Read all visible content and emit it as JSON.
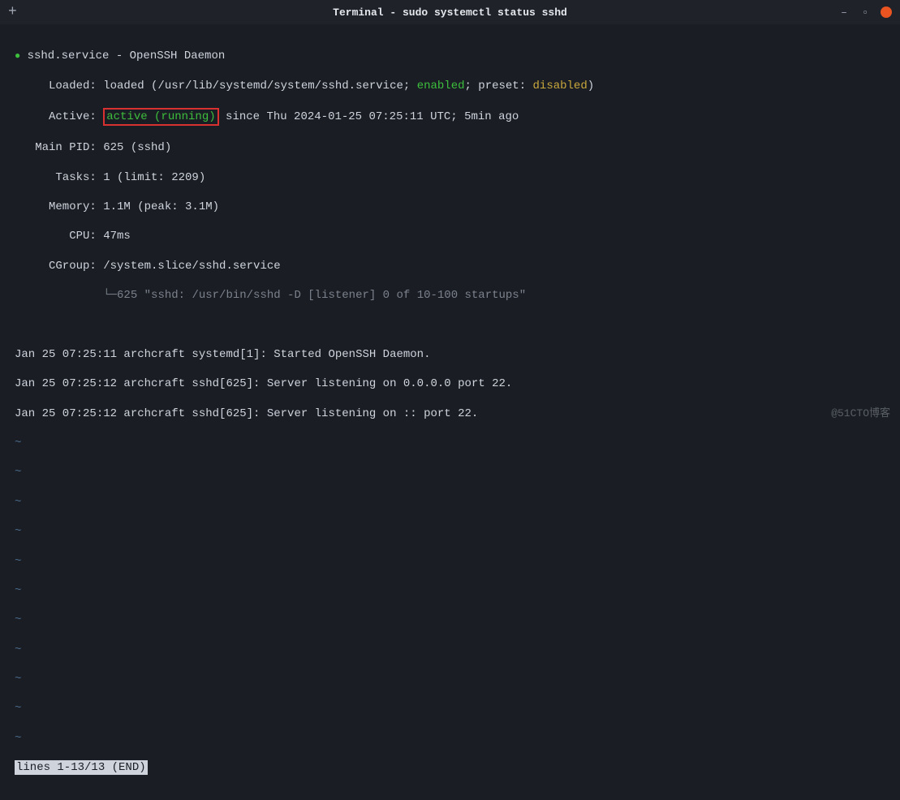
{
  "titlebar": {
    "add_tab": "+",
    "title": "Terminal - sudo systemctl status sshd",
    "minimize": "–",
    "maximize": "▫"
  },
  "service": {
    "bullet": "●",
    "name_line": " sshd.service - OpenSSH Daemon",
    "loaded_label": "     Loaded: ",
    "loaded_text1": "loaded (/usr/lib/systemd/system/sshd.service; ",
    "enabled": "enabled",
    "loaded_text2": "; preset: ",
    "disabled": "disabled",
    "loaded_text3": ")",
    "active_label": "     Active: ",
    "active_status": "active (running)",
    "active_since": " since Thu 2024-01-25 07:25:11 UTC; 5min ago",
    "main_pid": "   Main PID: 625 (sshd)",
    "tasks": "      Tasks: 1 (limit: 2209)",
    "memory": "     Memory: 1.1M (peak: 3.1M)",
    "cpu": "        CPU: 47ms",
    "cgroup": "     CGroup: /system.slice/sshd.service",
    "cgroup_tree": "             └─",
    "cgroup_proc": "625 \"sshd: /usr/bin/sshd -D [listener] 0 of 10-100 startups\""
  },
  "logs": {
    "l1": "Jan 25 07:25:11 archcraft systemd[1]: Started OpenSSH Daemon.",
    "l2": "Jan 25 07:25:12 archcraft sshd[625]: Server listening on 0.0.0.0 port 22.",
    "l3": "Jan 25 07:25:12 archcraft sshd[625]: Server listening on :: port 22."
  },
  "tilde": "~",
  "status_bar": "lines 1-13/13 (END)",
  "watermark": "@51CTO博客"
}
